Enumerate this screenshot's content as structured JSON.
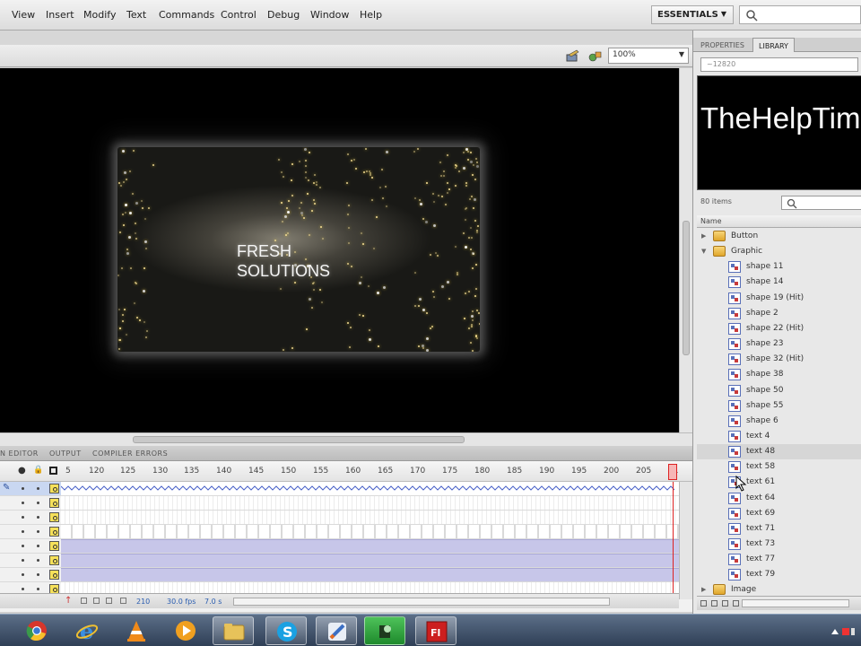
{
  "menubar": {
    "items": [
      "View",
      "Insert",
      "Modify",
      "Text",
      "Commands",
      "Control",
      "Debug",
      "Window",
      "Help"
    ],
    "workspace_label": "ESSENTIALS"
  },
  "stage": {
    "zoom": "100%",
    "title_text": "FRESH\nSOLUTIONS"
  },
  "bottom_tabs": [
    "N EDITOR",
    "OUTPUT",
    "COMPILER ERRORS"
  ],
  "timeline": {
    "frame_numbers": [
      "5",
      "120",
      "125",
      "130",
      "135",
      "140",
      "145",
      "150",
      "155",
      "160",
      "165",
      "170",
      "175",
      "180",
      "185",
      "190",
      "195",
      "200",
      "205",
      "21"
    ],
    "footer": {
      "current_frame": "210",
      "frame_rate": "30.0 fps",
      "elapsed": "7.0 s"
    }
  },
  "panel": {
    "tabs": [
      "PROPERTIES",
      "LIBRARY"
    ],
    "doc_name": "~12820",
    "preview_text": "TheHelpTim",
    "item_count": "80 items",
    "column_name": "Name",
    "items": [
      {
        "label": "Button",
        "type": "folder",
        "expanded": false
      },
      {
        "label": "Graphic",
        "type": "folder",
        "expanded": true
      },
      {
        "label": "shape 11",
        "type": "symbol"
      },
      {
        "label": "shape 14",
        "type": "symbol"
      },
      {
        "label": "shape 19 (Hit)",
        "type": "symbol"
      },
      {
        "label": "shape 2",
        "type": "symbol"
      },
      {
        "label": "shape 22 (Hit)",
        "type": "symbol"
      },
      {
        "label": "shape 23",
        "type": "symbol"
      },
      {
        "label": "shape 32 (Hit)",
        "type": "symbol"
      },
      {
        "label": "shape 38",
        "type": "symbol"
      },
      {
        "label": "shape 50",
        "type": "symbol"
      },
      {
        "label": "shape 55",
        "type": "symbol"
      },
      {
        "label": "shape 6",
        "type": "symbol"
      },
      {
        "label": "text 4",
        "type": "symbol"
      },
      {
        "label": "text 48",
        "type": "symbol",
        "selected": true
      },
      {
        "label": "text 58",
        "type": "symbol"
      },
      {
        "label": "text 61",
        "type": "symbol"
      },
      {
        "label": "text 64",
        "type": "symbol"
      },
      {
        "label": "text 69",
        "type": "symbol"
      },
      {
        "label": "text 71",
        "type": "symbol"
      },
      {
        "label": "text 73",
        "type": "symbol"
      },
      {
        "label": "text 77",
        "type": "symbol"
      },
      {
        "label": "text 79",
        "type": "symbol"
      },
      {
        "label": "Image",
        "type": "folder",
        "expanded": false
      }
    ]
  },
  "taskbar": {
    "apps": [
      "chrome-icon",
      "ie-icon",
      "vlc-icon",
      "media-player-icon",
      "explorer-icon",
      "skype-icon",
      "pen-tool-icon",
      "camtasia-icon",
      "flash-icon"
    ]
  },
  "colors": {
    "accent_blue": "#c7c6e9",
    "playhead": "#d22222",
    "flash_red": "#cc1f1f"
  }
}
